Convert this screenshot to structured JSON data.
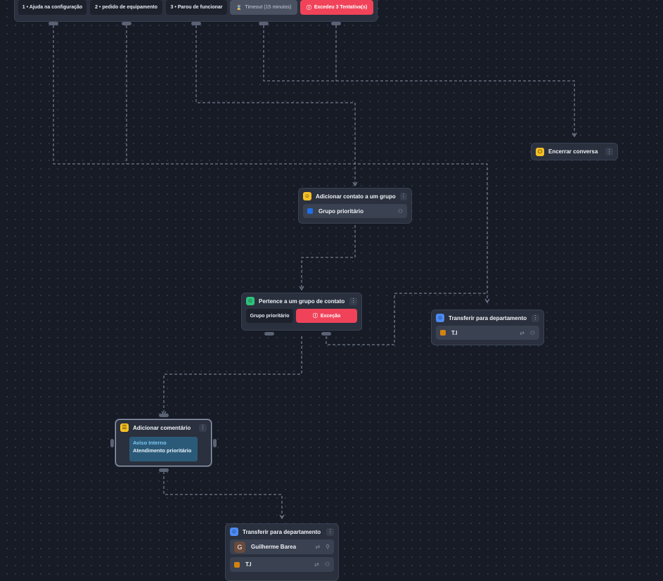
{
  "topbar": {
    "options": [
      "1 • Ajuda na configuração",
      "2 • pedido de equipamento",
      "3 • Parou de funcionar",
      "Timeout (15 minutos)",
      "Excedeu 3 Tentativa(s)"
    ]
  },
  "nodes": {
    "encerrar": {
      "title": "Encerrar conversa"
    },
    "adicionar_grupo": {
      "title": "Adicionar contato a um grupo",
      "group": "Grupo prioritário"
    },
    "pertence": {
      "title": "Pertence a um grupo de contato",
      "option_group": "Grupo prioritário",
      "option_exception": "Exceção"
    },
    "transferir_ti": {
      "title": "Transferir para departamento",
      "department": "T.I"
    },
    "comentario": {
      "title": "Adicionar comentário",
      "note_title": "Aviso Interno",
      "note_body": "Atendimento prioritário"
    },
    "transferir_bottom": {
      "title": "Transferir para departamento",
      "agent_initial": "G",
      "agent": "Guilherme Barea",
      "department": "T.I"
    }
  },
  "colors": {
    "canvas": "#161b26",
    "node": "#2a303d",
    "exception": "#f0435a",
    "group_blue": "#1f6feb",
    "dept_orange": "#d4820f"
  },
  "icons": [
    "hourglass-icon",
    "alert-circle-icon",
    "power-icon",
    "group-add-icon",
    "group-check-icon",
    "transfer-icon",
    "comment-icon",
    "kebab-menu-icon",
    "arrow-transfer-icon",
    "users-icon",
    "user-icon"
  ]
}
